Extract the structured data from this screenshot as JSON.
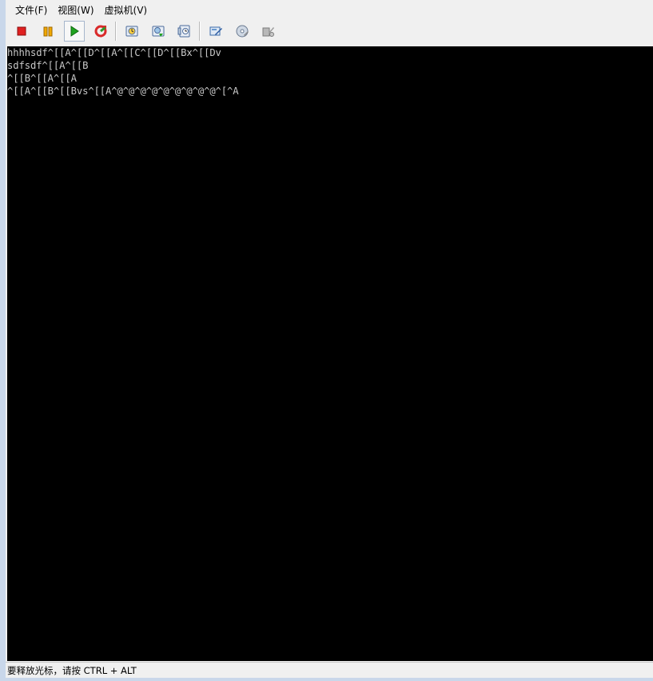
{
  "menu": [
    {
      "label": "文件(F)"
    },
    {
      "label": "视图(W)"
    },
    {
      "label": "虚拟机(V)"
    }
  ],
  "toolbar": [
    {
      "icon": "stop-icon"
    },
    {
      "icon": "pause-icon"
    },
    {
      "icon": "play-icon"
    },
    {
      "icon": "reset-icon"
    },
    {
      "icon": "snapshot-icon"
    },
    {
      "icon": "snapshot-restore-icon"
    },
    {
      "icon": "snapshot-manager-icon"
    },
    {
      "icon": "settings-icon"
    },
    {
      "icon": "cd-icon"
    },
    {
      "icon": "tools-icon"
    }
  ],
  "console": {
    "lines": [
      "hhhhsdf^[[A^[[D^[[A^[[C^[[D^[[Bx^[[Dv",
      "sdfsdf^[[A^[[B",
      "^[[B^[[A^[[A",
      "^[[A^[[B^[[Bvs^[[A^@^@^@^@^@^@^@^@^@^[^A"
    ]
  },
  "status": {
    "text": "要释放光标，请按 CTRL + ALT"
  },
  "colors": {
    "stop": "#e02020",
    "pause": "#e8a000",
    "play": "#1fa21f",
    "reset": "#d92a2a",
    "console_bg": "#000000",
    "console_fg": "#c8c8c8"
  }
}
